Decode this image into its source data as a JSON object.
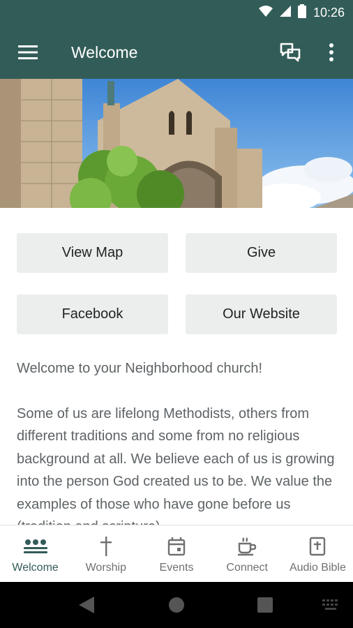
{
  "status_bar": {
    "time": "10:26"
  },
  "app_bar": {
    "title": "Welcome"
  },
  "colors": {
    "primary": "#325c58",
    "button_bg": "#eceeee",
    "body_text": "#5e6366"
  },
  "buttons": [
    "View Map",
    "Give",
    "Facebook",
    "Our Website"
  ],
  "content": {
    "welcome_line": "Welcome to your Neighborhood church!",
    "paragraph": "Some of us are lifelong Methodists, others from different traditions and some from no religious background at all. We believe each of us is growing into the person God created us to be. We value the examples of those who have gone before us (tradition and scripture)"
  },
  "bottom_nav": [
    {
      "label": "Welcome",
      "icon": "people-icon",
      "active": true
    },
    {
      "label": "Worship",
      "icon": "cross-icon",
      "active": false
    },
    {
      "label": "Events",
      "icon": "calendar-icon",
      "active": false
    },
    {
      "label": "Connect",
      "icon": "coffee-cup-icon",
      "active": false
    },
    {
      "label": "Audio Bible",
      "icon": "bible-icon",
      "active": false
    }
  ]
}
